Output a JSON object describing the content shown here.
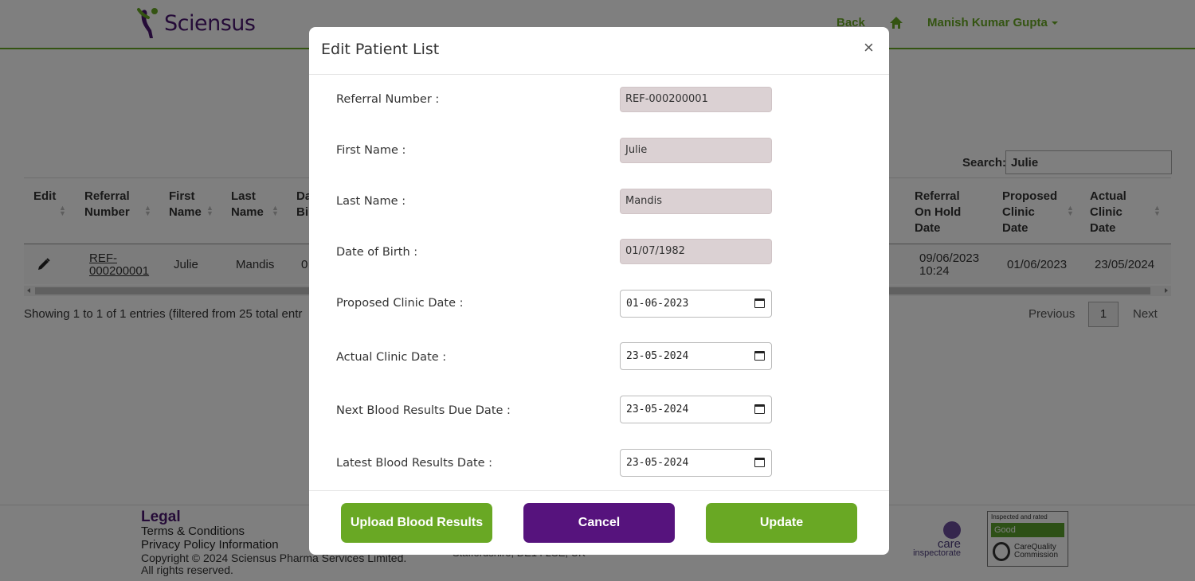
{
  "header": {
    "logo_text": "Sciensus",
    "back_label": "Back",
    "user_name": "Manish Kumar Gupta"
  },
  "search": {
    "label": "Search:",
    "value": "Julie"
  },
  "table": {
    "headers": {
      "edit": [
        "Edit"
      ],
      "referral_number": [
        "Referral",
        "Number"
      ],
      "first_name": [
        "First",
        "Name"
      ],
      "last_name": [
        "Last",
        "Name"
      ],
      "dob": [
        "Da",
        "Bir"
      ],
      "referral_on_hold": [
        "Referral",
        "On Hold",
        "Date"
      ],
      "proposed_clinic": [
        "Proposed",
        "Clinic",
        "Date"
      ],
      "actual_clinic": [
        "Actual",
        "Clinic",
        "Date"
      ]
    },
    "row": {
      "referral_number": [
        "REF-",
        "000200001"
      ],
      "first_name": "Julie",
      "last_name": "Mandis",
      "dob_partial": "0",
      "referral_on_hold": [
        "09/06/2023",
        "10:24"
      ],
      "proposed_clinic": "01/06/2023",
      "actual_clinic": "23/05/2024"
    },
    "info": "Showing 1 to 1 of 1 entries (filtered from 25 total entr"
  },
  "pagination": {
    "previous": "Previous",
    "current": "1",
    "next": "Next"
  },
  "footer": {
    "legal": "Legal",
    "terms": "Terms & Conditions",
    "privacy": "Privacy Policy Information",
    "copyright": "Copyright © 2024 Sciensus Pharma Services Limited.",
    "rights": "All rights reserved.",
    "address_partial": "Staffordshire, DE14 2SE, UK",
    "care_line1": "care",
    "care_line2": "inspectorate",
    "cqc_top": "Inspected and rated",
    "cqc_rating": "Good",
    "cqc_name1": "CareQuality",
    "cqc_name2": "Commission"
  },
  "modal": {
    "title": "Edit Patient List",
    "close": "×",
    "fields": {
      "referral_number": {
        "label": "Referral Number :",
        "value": "REF-000200001"
      },
      "first_name": {
        "label": "First Name :",
        "value": "Julie"
      },
      "last_name": {
        "label": "Last Name :",
        "value": "Mandis"
      },
      "dob": {
        "label": "Date of Birth :",
        "value": "01/07/1982"
      },
      "proposed_clinic_date": {
        "label": "Proposed Clinic Date :",
        "value": "01-06-2023"
      },
      "actual_clinic_date": {
        "label": "Actual Clinic Date :",
        "value": "23-05-2024"
      },
      "next_blood_due": {
        "label": "Next Blood Results Due Date :",
        "value": "23-05-2024"
      },
      "latest_blood": {
        "label": "Latest Blood Results Date :",
        "value": "23-05-2024"
      }
    },
    "buttons": {
      "upload": "Upload Blood Results",
      "cancel": "Cancel",
      "update": "Update"
    }
  },
  "colors": {
    "brand_green": "#69a824",
    "brand_purple": "#56137d",
    "readonly_bg": "#dbd1d3"
  }
}
